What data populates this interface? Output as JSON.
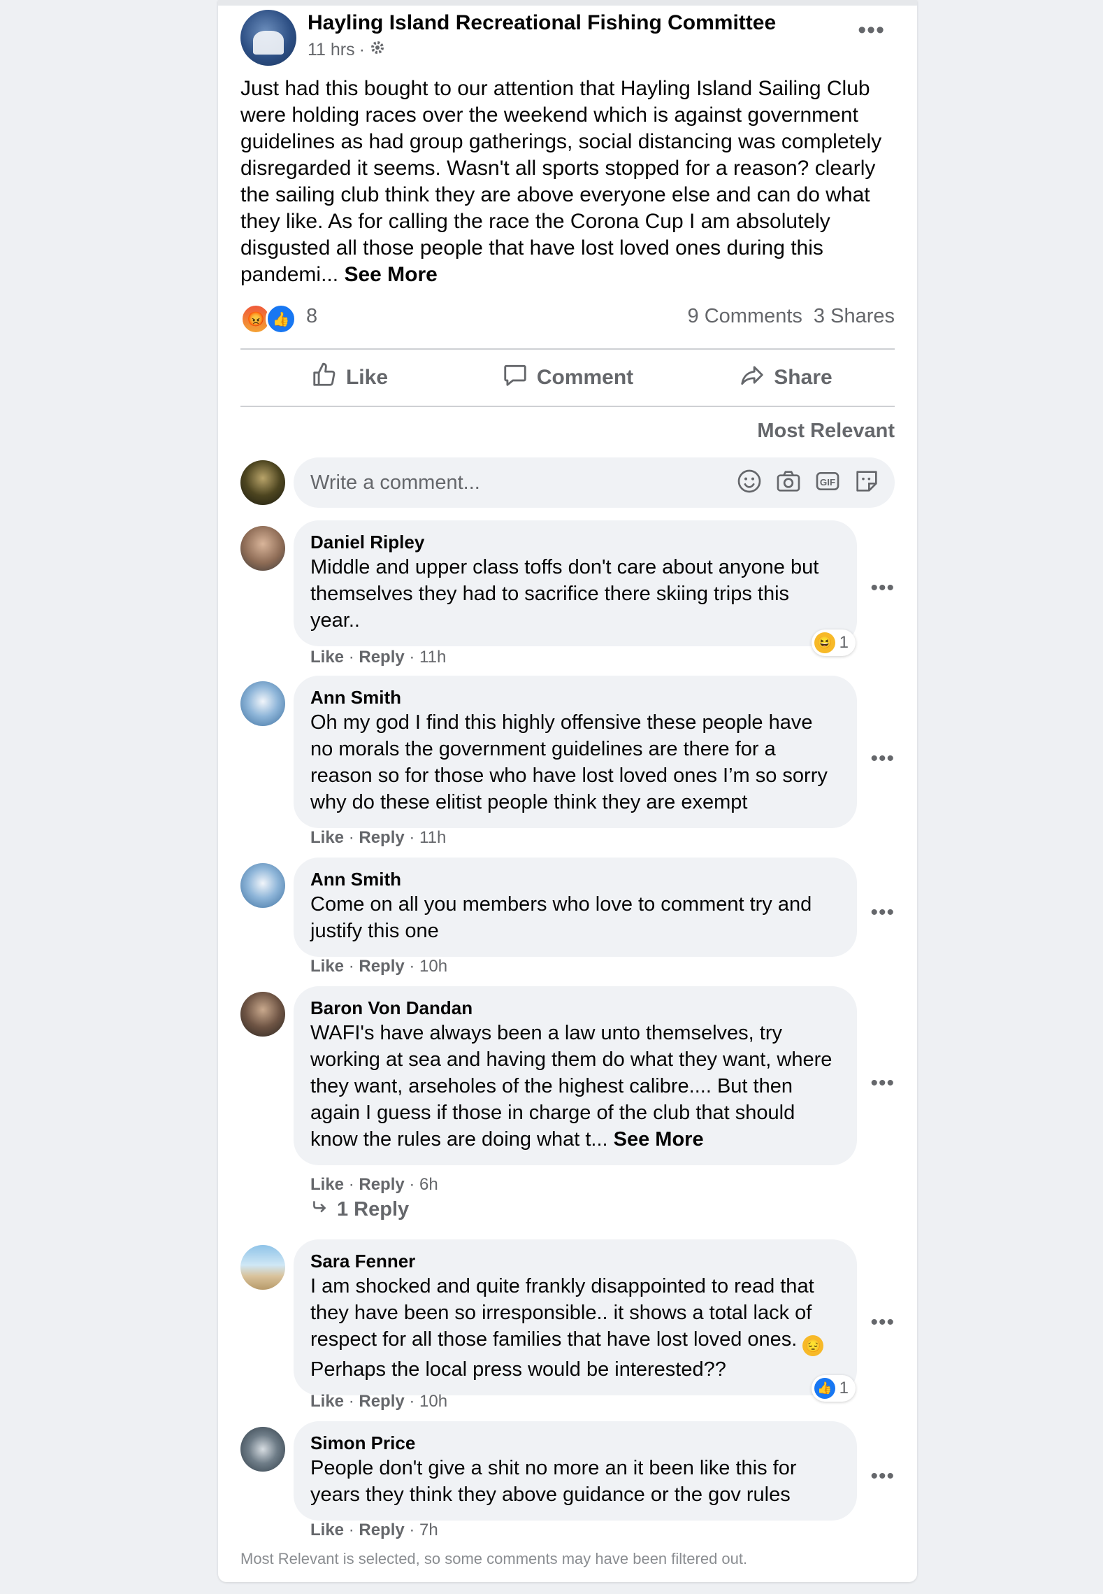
{
  "post": {
    "author": "Hayling Island Recreational Fishing Committee",
    "time": "11 hrs",
    "dot": "·",
    "audience_icon": "gear-icon",
    "text": "Just had this bought to our attention that Hayling Island Sailing Club were holding races over the weekend which is against government guidelines as had group gatherings, social distancing was completely disregarded it seems. Wasn't all sports stopped for a reason? clearly the sailing club think they are above everyone else and can do what they like. As for calling the race the Corona Cup I am absolutely disgusted all those people that have lost loved ones during this pandemi...",
    "see_more": "See More",
    "reaction_count": "8",
    "comments_count": "9 Comments",
    "shares_count": "3 Shares"
  },
  "actions": {
    "like": "Like",
    "comment": "Comment",
    "share": "Share"
  },
  "sort_label": "Most Relevant",
  "composer": {
    "placeholder": "Write a comment..."
  },
  "comments": [
    {
      "name": "Daniel Ripley",
      "text": "Middle and upper class toffs don't care about anyone but themselves they had to sacrifice there skiing trips this year..",
      "like": "Like",
      "reply": "Reply",
      "time": "11h",
      "reaction": "1"
    },
    {
      "name": "Ann Smith",
      "text": "Oh my god I find this highly offensive these people have no morals the government guidelines are there for a reason so for those who have lost loved ones I’m so sorry why do these elitist people think they are exempt",
      "like": "Like",
      "reply": "Reply",
      "time": "11h"
    },
    {
      "name": "Ann Smith",
      "text": "Come on all you members who love to comment try and justify this one",
      "like": "Like",
      "reply": "Reply",
      "time": "10h"
    },
    {
      "name": "Baron Von Dandan",
      "text": "WAFI's have always been a law unto themselves, try working at sea and having them do what they want, where they want, arseholes of the highest calibre.... But then again I guess if those in charge of the club that should know the rules are doing what t...",
      "see_more": "See More",
      "like": "Like",
      "reply": "Reply",
      "time": "6h",
      "replies": "1 Reply"
    },
    {
      "name": "Sara Fenner",
      "text_before": "I am shocked and quite frankly disappointed to read that they have been so irresponsible.. it shows a total lack of respect for all those families that have lost loved ones.",
      "text_after": "Perhaps the local press would be interested??",
      "like": "Like",
      "reply": "Reply",
      "time": "10h",
      "reaction": "1"
    },
    {
      "name": "Simon Price",
      "text": "People don't give a shit no more an it been like this for years they think they above guidance or the gov rules",
      "like": "Like",
      "reply": "Reply",
      "time": "7h"
    }
  ],
  "footer_note": "Most Relevant is selected, so some comments may have been filtered out.",
  "colors": {
    "page_bg": "#eef0f3",
    "card_bg": "#ffffff",
    "bubble_bg": "#f0f2f5",
    "secondary_text": "#65676b",
    "like_blue": "#1877f2"
  }
}
